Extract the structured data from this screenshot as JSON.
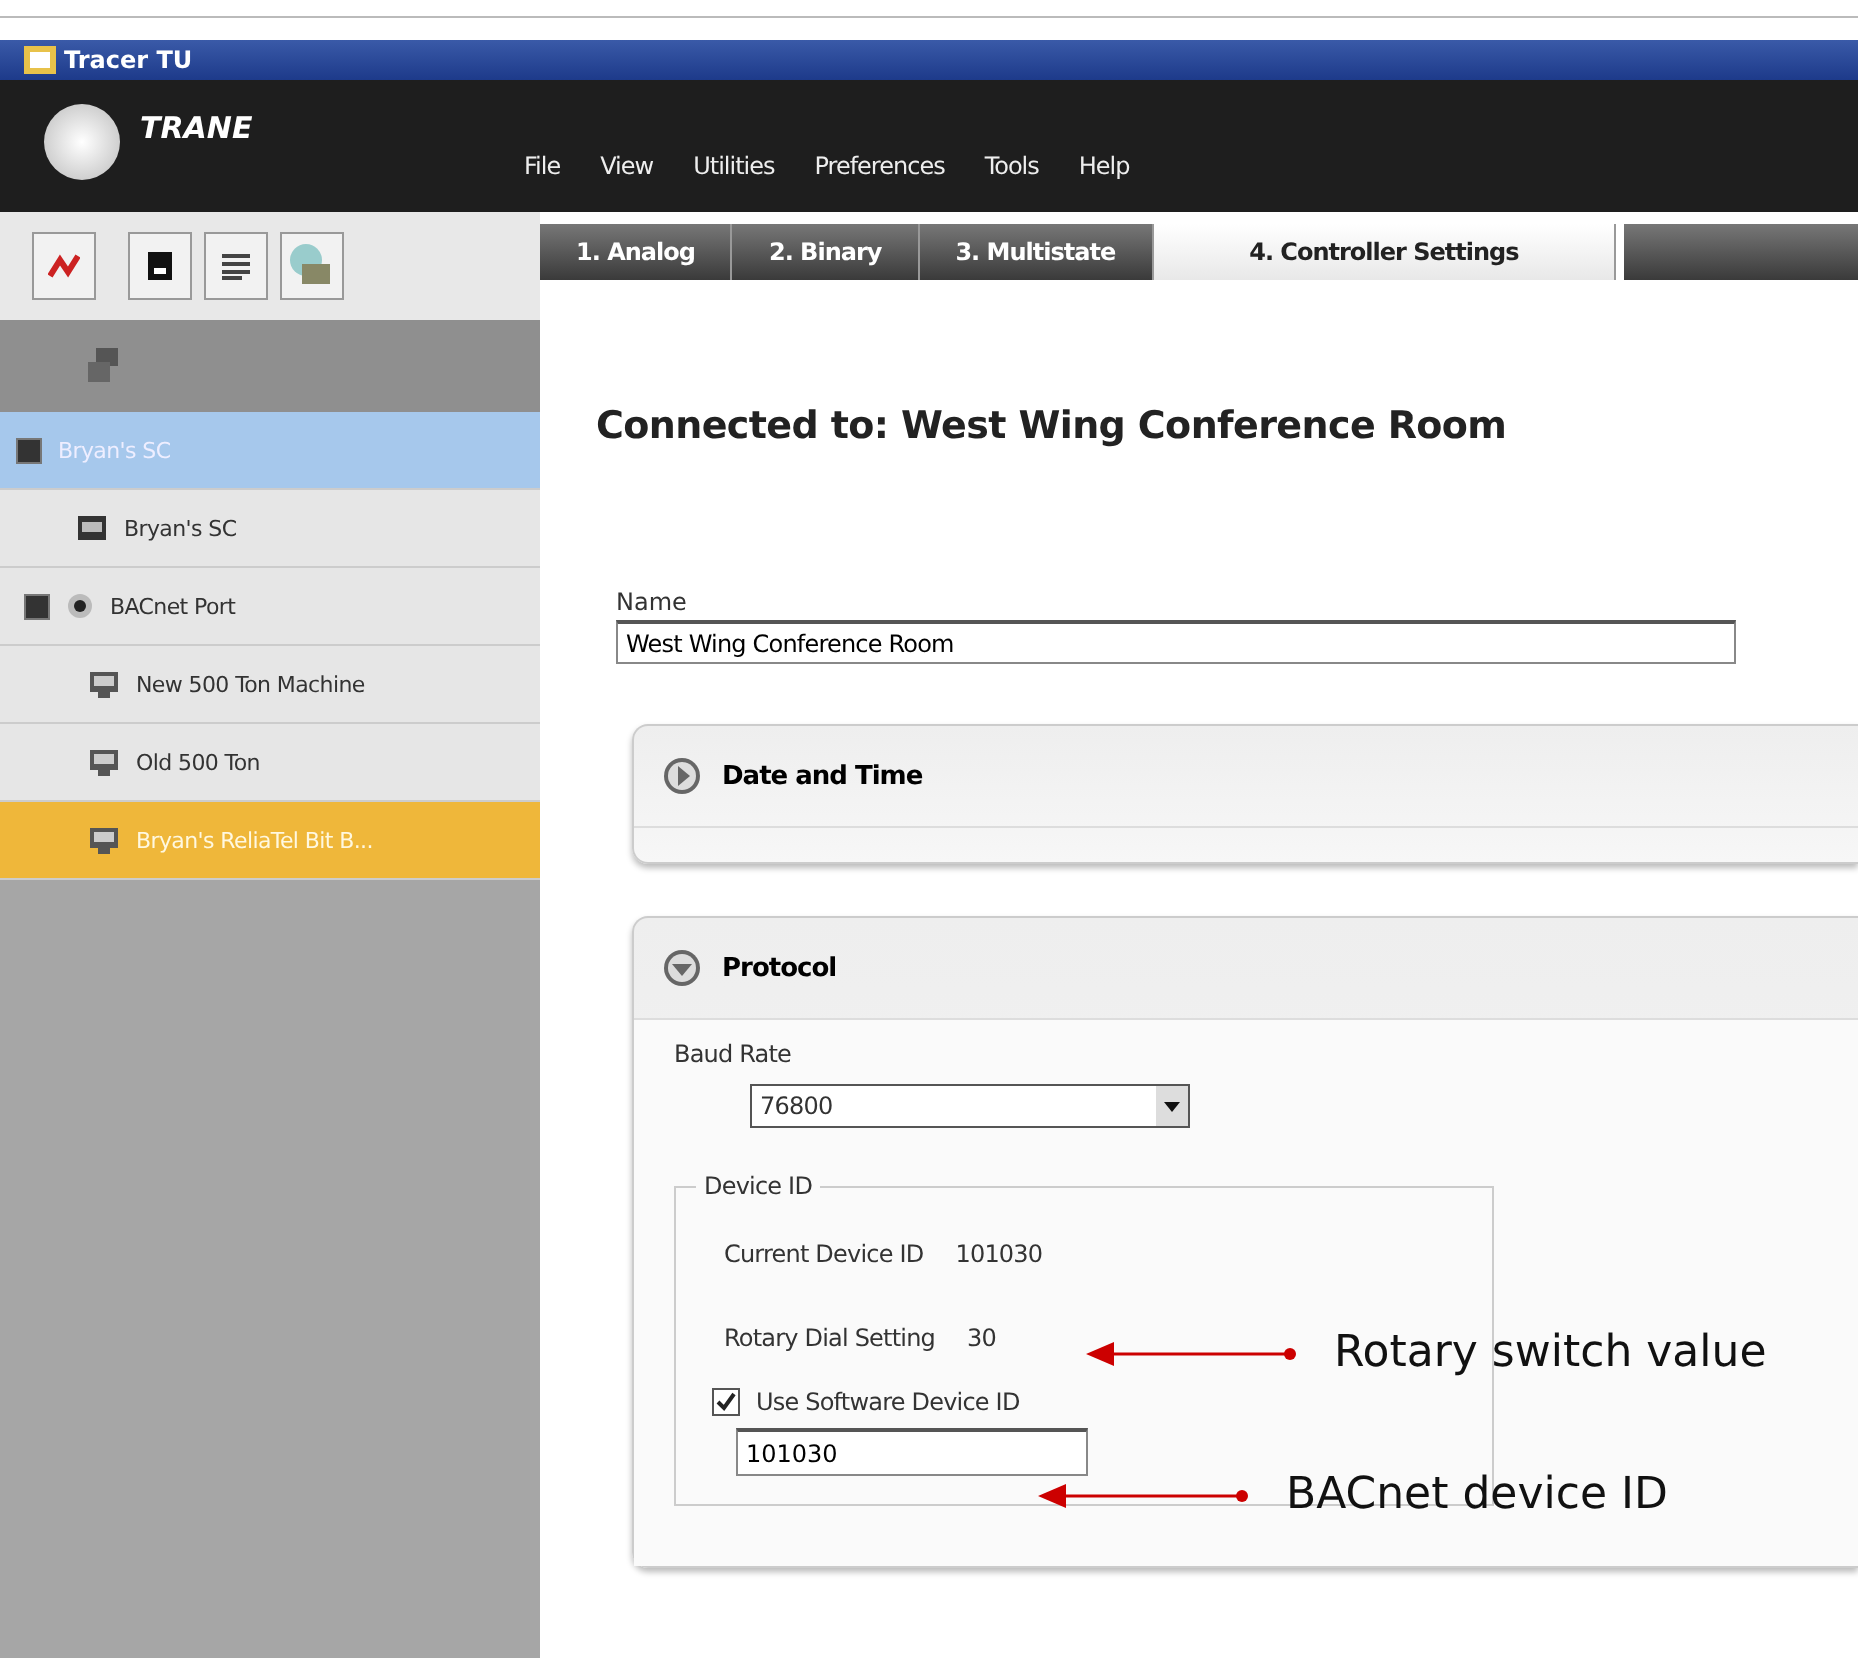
{
  "window": {
    "title": "Tracer TU"
  },
  "header": {
    "logo": "TRANE",
    "menu": [
      "File",
      "View",
      "Utilities",
      "Preferences",
      "Tools",
      "Help"
    ]
  },
  "tabs": [
    {
      "label": "1. Analog",
      "selected": false
    },
    {
      "label": "2. Binary",
      "selected": false
    },
    {
      "label": "3. Multistate",
      "selected": false
    },
    {
      "label": "4. Controller Settings",
      "selected": true
    }
  ],
  "tree": [
    {
      "label": "Bryan's SC",
      "expanded": true,
      "highlighted": true,
      "selected": false,
      "children": [
        {
          "label": "Bryan's SC",
          "kind": "controller",
          "highlighted": false,
          "selected": false
        },
        {
          "label": "BACnet Port",
          "kind": "port",
          "expanded": true,
          "highlighted": false,
          "selected": false,
          "children": [
            {
              "label": "New 500 Ton Machine",
              "kind": "unit",
              "highlighted": false,
              "selected": false
            },
            {
              "label": "Old 500 Ton",
              "kind": "unit",
              "highlighted": false,
              "selected": false
            },
            {
              "label": "Bryan's ReliaTel Bit B...",
              "kind": "unit",
              "highlighted": false,
              "selected": true
            }
          ]
        }
      ]
    }
  ],
  "content": {
    "heading": "Connected to: West Wing Conference Room",
    "name_label": "Name",
    "name_value": "West Wing Conference Room",
    "sections": [
      {
        "title": "Date and Time",
        "expanded": false
      },
      {
        "title": "Protocol",
        "expanded": true,
        "baud_label": "Baud Rate",
        "baud_value": "76800",
        "group_title": "Device ID",
        "current_label": "Current Device ID",
        "current_value": "101030",
        "rotary_label": "Rotary Dial Setting",
        "rotary_value": "30",
        "use_software_label": "Use Software Device ID",
        "use_software_checked": true,
        "software_id": "101030"
      }
    ]
  },
  "annotations": [
    {
      "text": "Rotary switch value"
    },
    {
      "text": "BACnet device ID"
    }
  ]
}
